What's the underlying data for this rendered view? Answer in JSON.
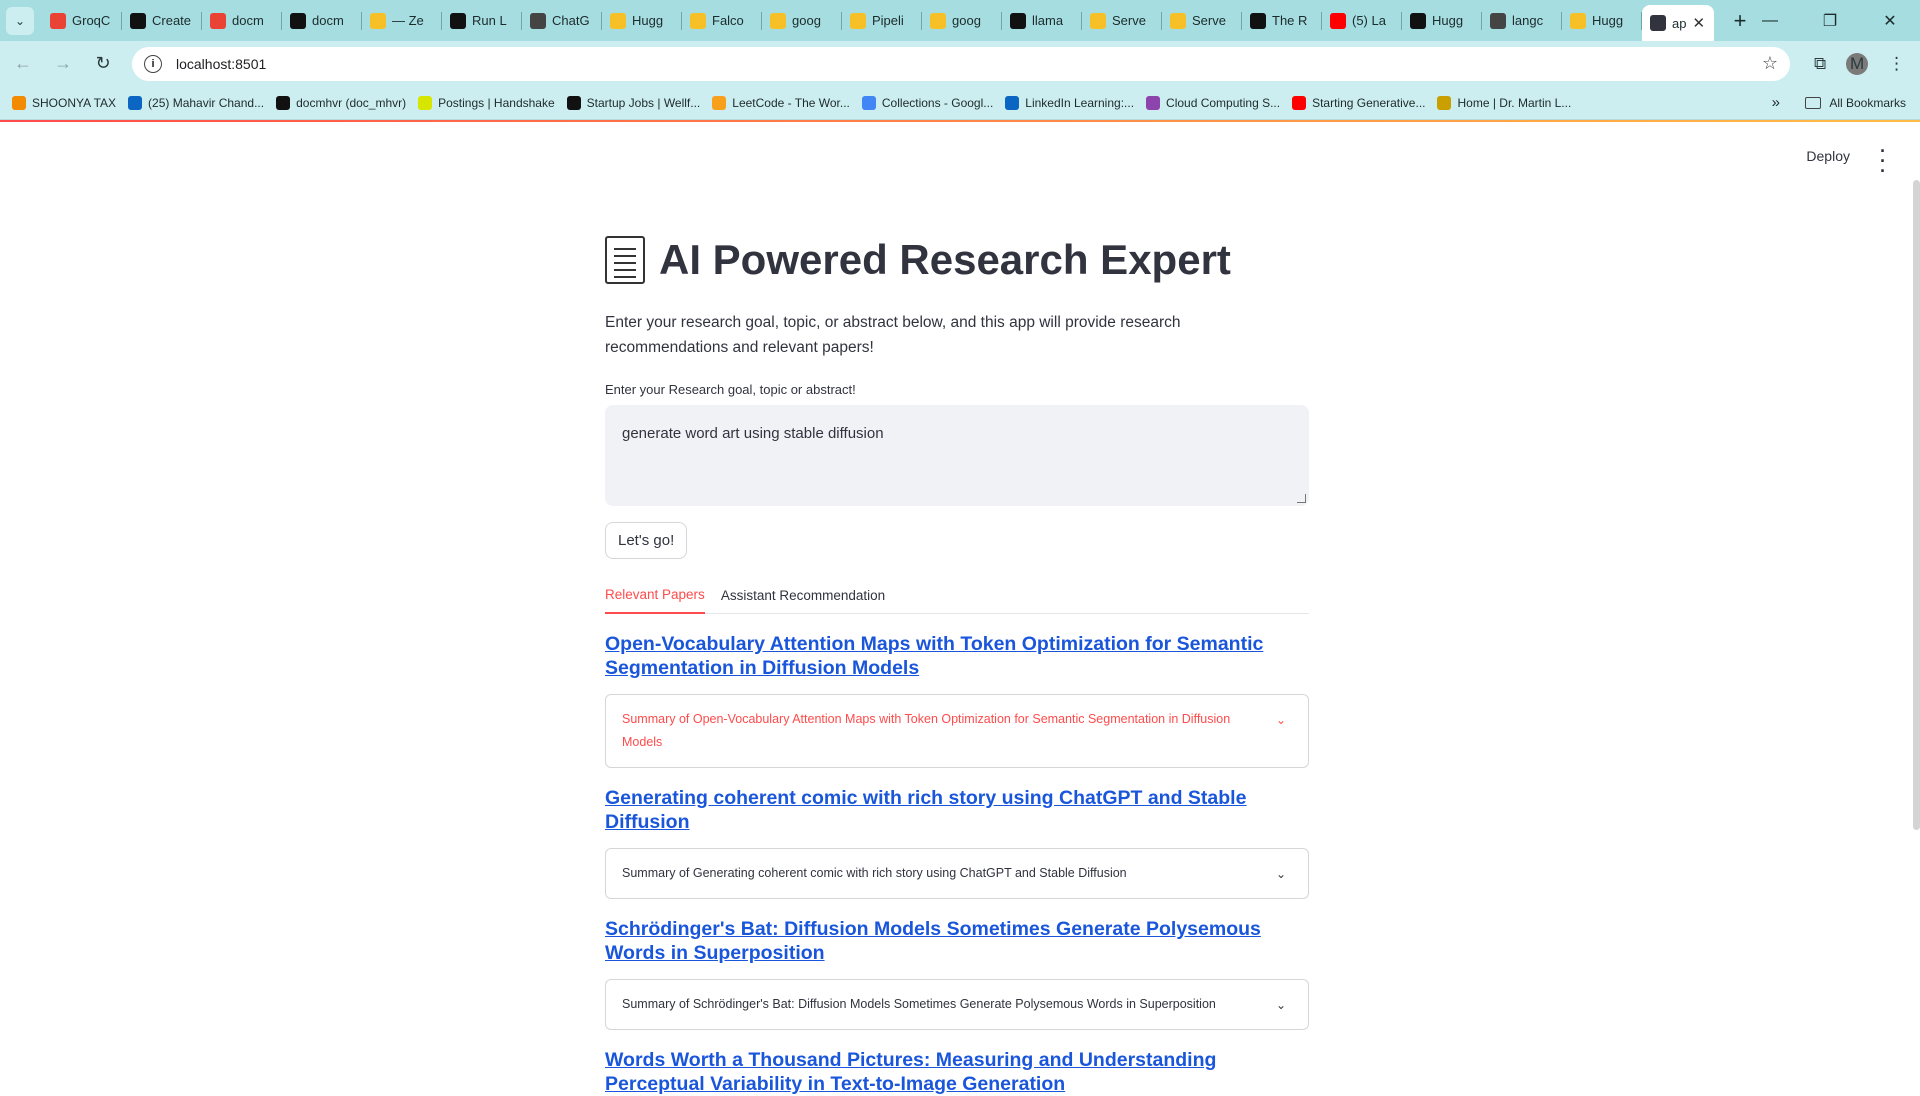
{
  "browser": {
    "tabs": [
      {
        "title": "GroqC",
        "icon": "groq-icon",
        "color": "#ea4335"
      },
      {
        "title": "Create",
        "icon": "openai-icon",
        "color": "#111111"
      },
      {
        "title": "docm",
        "icon": "crown-icon",
        "color": "#ea4335"
      },
      {
        "title": "docm",
        "icon": "github-icon",
        "color": "#111111"
      },
      {
        "title": "— Ze",
        "icon": "huggingface-icon",
        "color": "#f6c026"
      },
      {
        "title": "Run L",
        "icon": "medium-icon",
        "color": "#111111"
      },
      {
        "title": "ChatG",
        "icon": "openai-icon",
        "color": "#444444"
      },
      {
        "title": "Hugg",
        "icon": "huggingface-icon",
        "color": "#f6c026"
      },
      {
        "title": "Falco",
        "icon": "huggingface-icon",
        "color": "#f6c026"
      },
      {
        "title": "goog",
        "icon": "huggingface-icon",
        "color": "#f6c026"
      },
      {
        "title": "Pipeli",
        "icon": "huggingface-icon",
        "color": "#f6c026"
      },
      {
        "title": "goog",
        "icon": "huggingface-icon",
        "color": "#f6c026"
      },
      {
        "title": "llama",
        "icon": "github-icon",
        "color": "#111111"
      },
      {
        "title": "Serve",
        "icon": "huggingface-icon",
        "color": "#f6c026"
      },
      {
        "title": "Serve",
        "icon": "huggingface-icon",
        "color": "#f6c026"
      },
      {
        "title": "The R",
        "icon": "medium-icon",
        "color": "#111111"
      },
      {
        "title": "(5) La",
        "icon": "youtube-icon",
        "color": "#ff0000"
      },
      {
        "title": "Hugg",
        "icon": "paperswithcode-icon",
        "color": "#111111"
      },
      {
        "title": "langc",
        "icon": "notion-icon",
        "color": "#444444"
      },
      {
        "title": "Hugg",
        "icon": "huggingface-icon",
        "color": "#f6c026"
      }
    ],
    "active_tab": {
      "title": "ap",
      "icon": "streamlit-icon"
    },
    "url": "localhost:8501",
    "profile_initial": "M",
    "bookmarks": [
      {
        "label": "SHOONYA TAX",
        "icon": "search-icon",
        "color": "#f28b00"
      },
      {
        "label": "(25) Mahavir Chand...",
        "icon": "linkedin-icon",
        "color": "#0a66c2"
      },
      {
        "label": "docmhvr (doc_mhvr)",
        "icon": "github-icon",
        "color": "#111111"
      },
      {
        "label": "Postings | Handshake",
        "icon": "handshake-icon",
        "color": "#d7e600"
      },
      {
        "label": "Startup Jobs | Wellf...",
        "icon": "wellfound-icon",
        "color": "#111111"
      },
      {
        "label": "LeetCode - The Wor...",
        "icon": "leetcode-icon",
        "color": "#f89f1b"
      },
      {
        "label": "Collections - Googl...",
        "icon": "google-icon",
        "color": "#4285f4"
      },
      {
        "label": "LinkedIn Learning:...",
        "icon": "linkedin-learning-icon",
        "color": "#0a66c2"
      },
      {
        "label": "Cloud Computing S...",
        "icon": "cube-icon",
        "color": "#8e44ad"
      },
      {
        "label": "Starting Generative...",
        "icon": "youtube-icon",
        "color": "#ff0000"
      },
      {
        "label": "Home | Dr. Martin L...",
        "icon": "owl-icon",
        "color": "#c9a000"
      }
    ],
    "all_bookmarks": "All Bookmarks"
  },
  "app": {
    "deploy_label": "Deploy",
    "title": "AI Powered Research Expert",
    "intro": "Enter your research goal, topic, or abstract below, and this app will provide research recommendations and relevant papers!",
    "input_label": "Enter your Research goal, topic or abstract!",
    "input_value": "generate word art using stable diffusion",
    "button_label": "Let's go!",
    "tabs": [
      "Relevant Papers",
      "Assistant Recommendation"
    ],
    "papers": [
      {
        "title": "Open-Vocabulary Attention Maps with Token Optimization for Semantic Segmentation in Diffusion Models",
        "summary_label": "Summary of Open-Vocabulary Attention Maps with Token Optimization for Semantic Segmentation in Diffusion Models"
      },
      {
        "title": "Generating coherent comic with rich story using ChatGPT and Stable Diffusion",
        "summary_label": "Summary of Generating coherent comic with rich story using ChatGPT and Stable Diffusion"
      },
      {
        "title": "Schrödinger's Bat: Diffusion Models Sometimes Generate Polysemous Words in Superposition",
        "summary_label": "Summary of Schrödinger's Bat: Diffusion Models Sometimes Generate Polysemous Words in Superposition"
      },
      {
        "title": "Words Worth a Thousand Pictures: Measuring and Understanding Perceptual Variability in Text-to-Image Generation",
        "summary_label": ""
      }
    ]
  }
}
